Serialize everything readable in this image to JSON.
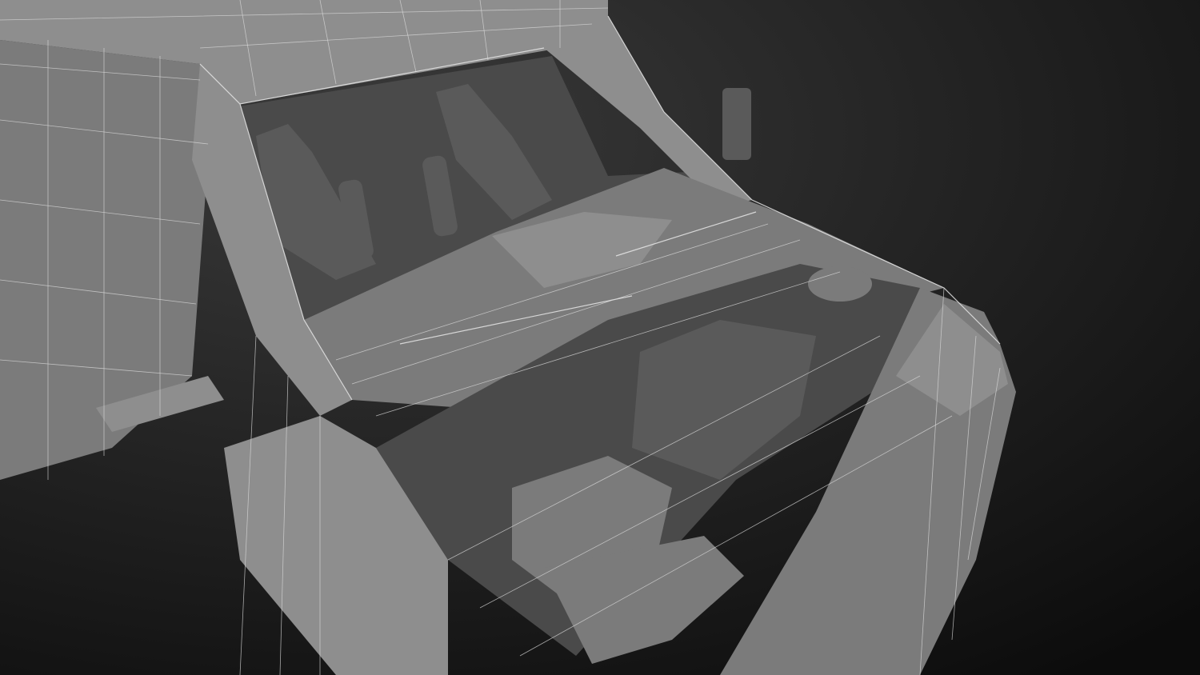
{
  "colors": {
    "background_light": "#3a3a3a",
    "background_dark": "#0c0c0c",
    "model_base": "#7b7b7b",
    "wireframe": "#d8d8d8"
  }
}
